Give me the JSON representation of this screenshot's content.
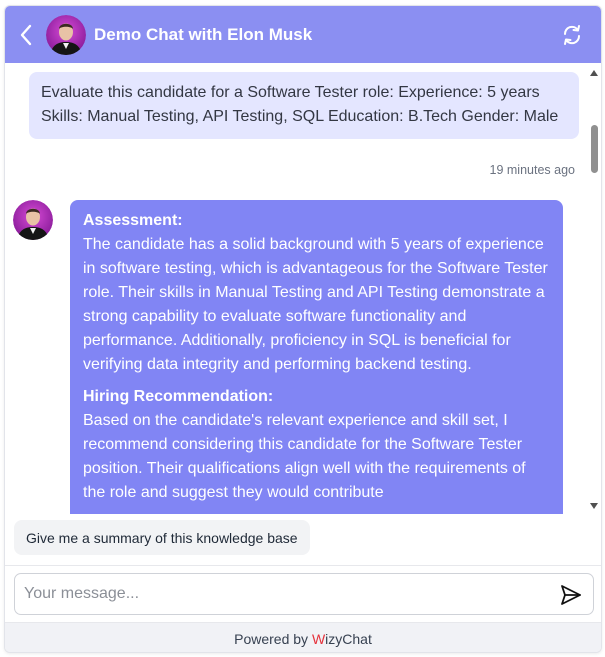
{
  "header": {
    "title": "Demo Chat with Elon Musk",
    "back_icon": "chevron-left-icon",
    "refresh_icon": "refresh-icon",
    "background_color": "#8b8ff2"
  },
  "messages": {
    "user_message": {
      "text": "Evaluate this candidate for a Software Tester role: Experience: 5 years Skills: Manual Testing, API Testing, SQL Education: B.Tech Gender: Male",
      "timestamp": "19 minutes ago",
      "bubble_color": "#e4e6ff"
    },
    "bot_message": {
      "bubble_color": "#8185f4",
      "sections": [
        {
          "heading": "Assessment:",
          "body": "The candidate has a solid background with 5 years of experience in software testing, which is advantageous for the Software Tester role. Their skills in Manual Testing and API Testing demonstrate a strong capability to evaluate software functionality and performance. Additionally, proficiency in SQL is beneficial for verifying data integrity and performing backend testing."
        },
        {
          "heading": "Hiring Recommendation:",
          "body": "Based on the candidate's relevant experience and skill set, I recommend considering this candidate for the Software Tester position. Their qualifications align well with the requirements of the role and suggest they would contribute"
        }
      ]
    }
  },
  "suggestion": {
    "label": "Give me a summary of this knowledge base"
  },
  "composer": {
    "placeholder": "Your message...",
    "send_icon": "send-icon"
  },
  "footer": {
    "powered_by": "Powered by",
    "brand_first_letter": "W",
    "brand_rest": "izyChat"
  }
}
